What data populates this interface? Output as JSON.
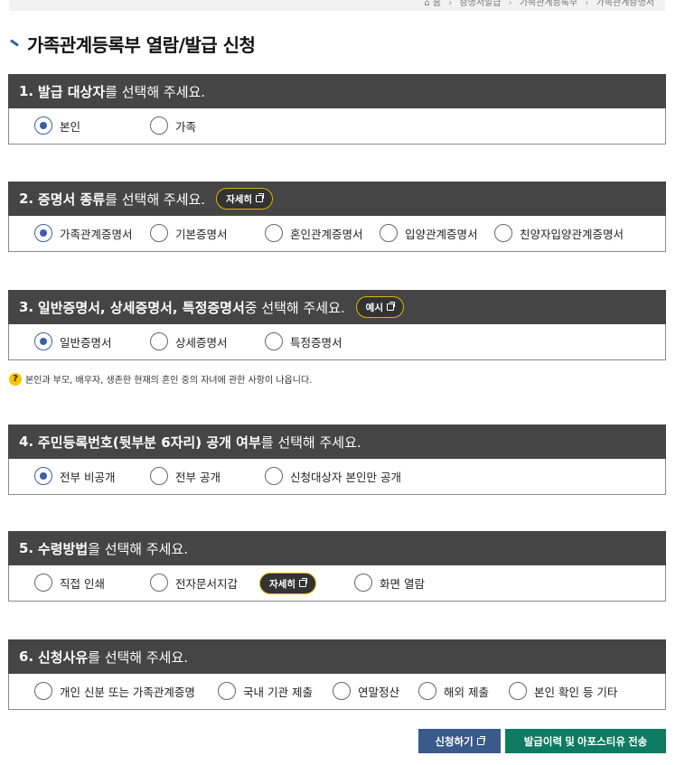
{
  "breadcrumb": {
    "home": "홈",
    "level1": "증명서발급",
    "level2": "가족관계등록부",
    "level3": "가족관계증명서"
  },
  "page_title": "가족관계등록부 열람/발급 신청",
  "sections": [
    {
      "num": "1.",
      "bold": "발급 대상자",
      "rest": "를 선택해 주세요.",
      "options": [
        {
          "label": "본인",
          "checked": true
        },
        {
          "label": "가족",
          "checked": false
        }
      ]
    },
    {
      "num": "2.",
      "bold": "증명서 종류",
      "rest": "를 선택해 주세요.",
      "pill": "자세히",
      "options": [
        {
          "label": "가족관계증명서",
          "checked": true
        },
        {
          "label": "기본증명서",
          "checked": false
        },
        {
          "label": "혼인관계증명서",
          "checked": false
        },
        {
          "label": "입양관계증명서",
          "checked": false
        },
        {
          "label": "친양자입양관계증명서",
          "checked": false
        }
      ]
    },
    {
      "num": "3.",
      "bold": "일반증명서, 상세증명서, 특정증명서",
      "rest": " 중 선택해 주세요.",
      "pill": "예시",
      "options": [
        {
          "label": "일반증명서",
          "checked": true
        },
        {
          "label": "상세증명서",
          "checked": false
        },
        {
          "label": "특정증명서",
          "checked": false
        }
      ]
    },
    {
      "num": "4.",
      "bold": "주민등록번호(뒷부분 6자리) 공개 여부",
      "rest": "를 선택해 주세요.",
      "options": [
        {
          "label": "전부 비공개",
          "checked": true
        },
        {
          "label": "전부 공개",
          "checked": false
        },
        {
          "label": "신청대상자 본인만 공개",
          "checked": false
        }
      ]
    },
    {
      "num": "5.",
      "bold": "수령방법",
      "rest": "을 선택해 주세요.",
      "options": [
        {
          "label": "직접 인쇄",
          "checked": false
        },
        {
          "label": "전자문서지갑",
          "checked": false
        },
        {
          "label": "화면 열람",
          "checked": false
        }
      ],
      "body_pill": "자세히"
    },
    {
      "num": "6.",
      "bold": "신청사유",
      "rest": "를 선택해 주세요.",
      "options": [
        {
          "label": "개인 신분 또는 가족관계증명",
          "checked": false
        },
        {
          "label": "국내 기관 제출",
          "checked": false
        },
        {
          "label": "연말정산",
          "checked": false
        },
        {
          "label": "해외 제출",
          "checked": false
        },
        {
          "label": "본인 확인 등 기타",
          "checked": false
        }
      ]
    }
  ],
  "note": "본인과 부모, 배우자, 생존한 현재의 혼인 중의 자녀에 관한 사항이 나옵니다.",
  "buttons": {
    "apply": "신청하기",
    "history": "발급이력 및 아포스티유 전송"
  },
  "colors": {
    "header_bg": "#454545",
    "radio_accent": "#3b5fa8",
    "pill_border": "#e2b400",
    "apply_btn": "#3a5a8c",
    "history_btn": "#0e7b62"
  }
}
